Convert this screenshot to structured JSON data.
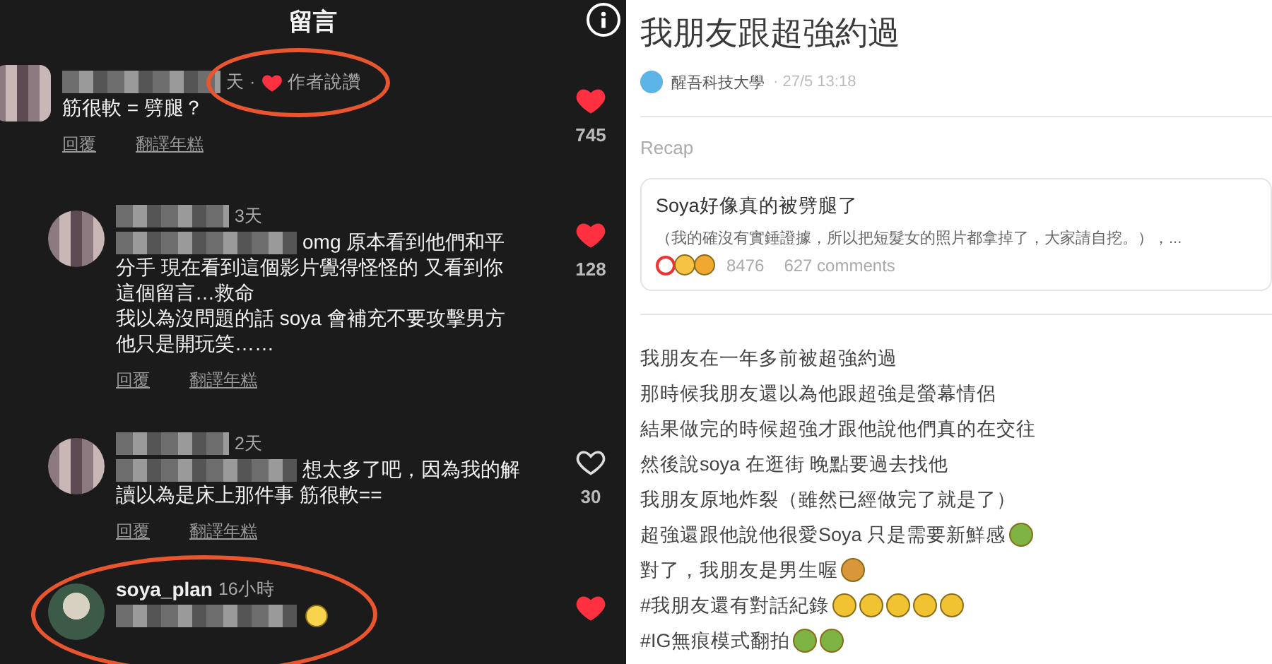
{
  "comments_panel": {
    "title": "留言",
    "comments": [
      {
        "kind": "comment",
        "time": "天 ·",
        "author_liked": true,
        "author_liked_label": "作者說讚",
        "meta_circled": true,
        "lines": [
          "筋很軟 = 劈腿？"
        ],
        "actions": [
          "回覆",
          "翻譯年糕"
        ],
        "liked": true,
        "likes": "745"
      },
      {
        "kind": "reply",
        "time": "3天",
        "text_blurred": true,
        "lines": [
          "omg 原本看到他們和平",
          "分手 現在看到這個影片覺得怪怪的 又看到你",
          "這個留言…救命",
          "我以為沒問題的話 soya 會補充不要攻擊男方",
          "他只是開玩笑……"
        ],
        "actions": [
          "回覆",
          "翻譯年糕"
        ],
        "liked": true,
        "likes": "128"
      },
      {
        "kind": "reply",
        "time": "2天",
        "text_blurred": true,
        "lines": [
          "想太多了吧，因為我的解",
          "讀以為是床上那件事 筋很軟=="
        ],
        "actions": [
          "回覆",
          "翻譯年糕"
        ],
        "liked": false,
        "likes": "30"
      },
      {
        "kind": "reply",
        "username": "soya_plan",
        "time": "16小時",
        "circled": true,
        "text_blurred": true,
        "emoji": [
          {
            "kind": "smile"
          }
        ],
        "liked": true
      }
    ]
  },
  "post": {
    "title": "我朋友跟超強約過",
    "school": "醒吾科技大學",
    "date": "· 27/5 13:18",
    "recap_label": "Recap",
    "recap_card": {
      "title": "Soya好像真的被劈腿了",
      "excerpt": "（我的確沒有實錘證據，所以把短髮女的照片都拿掉了，大家請自挖。），...",
      "reactions": [
        {
          "kind": "heart"
        },
        {
          "kind": "laugh"
        },
        {
          "kind": "wow"
        }
      ],
      "reaction_count": "8476",
      "comments": "627 comments"
    },
    "lines": [
      {
        "text": "我朋友在一年多前被超強約過"
      },
      {
        "text": "那時候我朋友還以為他跟超強是螢幕情侶"
      },
      {
        "text": "結果做完的時候超強才跟他說他們真的在交往"
      },
      {
        "text": "然後說soya 在逛街 晚點要過去找他"
      },
      {
        "text": "我朋友原地炸裂（雖然已經做完了就是了）"
      },
      {
        "text": "超強還跟他說他很愛Soya 只是需要新鮮感",
        "emoji": [
          {
            "kind": "nauseated"
          }
        ]
      },
      {
        "text": "對了，我朋友是男生喔",
        "emoji": [
          {
            "kind": "boy"
          }
        ]
      },
      {
        "text": "#我朋友還有對話紀錄",
        "emoji": [
          {
            "kind": "grin"
          },
          {
            "kind": "grin"
          },
          {
            "kind": "grin"
          },
          {
            "kind": "grin"
          },
          {
            "kind": "grin"
          }
        ]
      },
      {
        "text": "#IG無痕模式翻拍",
        "emoji": [
          {
            "kind": "nauseated"
          },
          {
            "kind": "nauseated"
          }
        ]
      }
    ]
  }
}
